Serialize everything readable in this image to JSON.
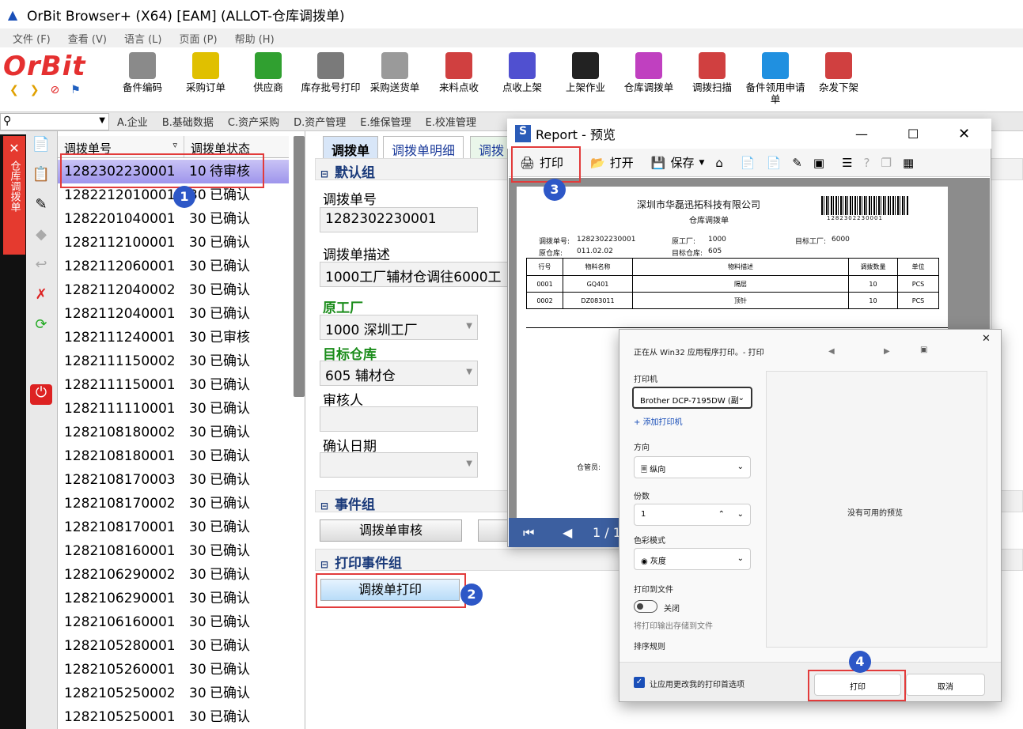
{
  "window": {
    "title": "OrBit Browser+ (X64) [EAM] (ALLOT-仓库调拨单)"
  },
  "menu": [
    "文件 (F)",
    "查看 (V)",
    "语言 (L)",
    "页面 (P)",
    "帮助 (H)"
  ],
  "brand": "OrBit",
  "toolbar": [
    {
      "label": "备件编码",
      "icon": "parts-code-icon"
    },
    {
      "label": "采购订单",
      "icon": "purchase-cart-icon"
    },
    {
      "label": "供应商",
      "icon": "supplier-icon"
    },
    {
      "label": "库存批号打印",
      "icon": "batch-print-icon"
    },
    {
      "label": "采购送货单",
      "icon": "delivery-note-icon"
    },
    {
      "label": "来料点收",
      "icon": "receive-icon"
    },
    {
      "label": "点收上架",
      "icon": "shelve-icon"
    },
    {
      "label": "上架作业",
      "icon": "shelving-op-icon"
    },
    {
      "label": "仓库调拨单",
      "icon": "transfer-icon"
    },
    {
      "label": "调拨扫描",
      "icon": "scan-icon"
    },
    {
      "label": "备件领用申请单",
      "icon": "request-icon"
    },
    {
      "label": "杂发下架",
      "icon": "misc-issue-icon"
    }
  ],
  "nav": [
    "A.企业",
    "B.基础数据",
    "C.资产采购",
    "D.资产管理",
    "E.维保管理",
    "E.校准管理"
  ],
  "sidetab": "仓库调拨单",
  "list": {
    "headers": [
      "调拨单号",
      "调拨单状态"
    ],
    "rows": [
      [
        "1282302230001",
        "10",
        "待审核"
      ],
      [
        "1282212010001",
        "30",
        "已确认"
      ],
      [
        "1282201040001",
        "30",
        "已确认"
      ],
      [
        "1282112100001",
        "30",
        "已确认"
      ],
      [
        "1282112060001",
        "30",
        "已确认"
      ],
      [
        "1282112040002",
        "30",
        "已确认"
      ],
      [
        "1282112040001",
        "30",
        "已确认"
      ],
      [
        "1282111240001",
        "30",
        "已审核"
      ],
      [
        "1282111150002",
        "30",
        "已确认"
      ],
      [
        "1282111150001",
        "30",
        "已确认"
      ],
      [
        "1282111110001",
        "30",
        "已确认"
      ],
      [
        "1282108180002",
        "30",
        "已确认"
      ],
      [
        "1282108180001",
        "30",
        "已确认"
      ],
      [
        "1282108170003",
        "30",
        "已确认"
      ],
      [
        "1282108170002",
        "30",
        "已确认"
      ],
      [
        "1282108170001",
        "30",
        "已确认"
      ],
      [
        "1282108160001",
        "30",
        "已确认"
      ],
      [
        "1282106290002",
        "30",
        "已确认"
      ],
      [
        "1282106290001",
        "30",
        "已确认"
      ],
      [
        "1282106160001",
        "30",
        "已确认"
      ],
      [
        "1282105280001",
        "30",
        "已确认"
      ],
      [
        "1282105260001",
        "30",
        "已确认"
      ],
      [
        "1282105250002",
        "30",
        "已确认"
      ],
      [
        "1282105250001",
        "30",
        "已确认"
      ]
    ]
  },
  "form": {
    "tabs": [
      "调拨单",
      "调拨单明细",
      "调拨"
    ],
    "group_default": "默认组",
    "lbl_no": "调拨单号",
    "val_no": "1282302230001",
    "lbl_desc": "调拨单描述",
    "val_desc": "1000工厂辅材仓调往6000工",
    "lbl_factory": "原工厂",
    "val_factory": "1000 深圳工厂",
    "lbl_wh": "目标仓库",
    "val_wh": "605 辅材仓",
    "lbl_auditor": "审核人",
    "lbl_confirm": "确认日期",
    "group_event": "事件组",
    "btn_audit": "调拨单审核",
    "group_print": "打印事件组",
    "btn_print": "调拨单打印"
  },
  "report": {
    "title": "Report - 预览",
    "tools": {
      "print": "打印",
      "open": "打开",
      "save": "保存"
    },
    "company": "深圳市华磊迅拓科技有限公司",
    "doc_title": "仓库调拨单",
    "barcode_text": "1282302230001",
    "h_no": "调拨单号:",
    "no": "1282302230001",
    "h_src_factory": "原工厂:",
    "src_factory": "1000",
    "h_dst_factory": "目标工厂:",
    "dst_factory": "6000",
    "h_src_wh": "原仓库:",
    "src_wh": "011.02.02",
    "h_dst_wh": "目标仓库:",
    "dst_wh": "605",
    "cols": [
      "行号",
      "物料名称",
      "物料描述",
      "调拨数量",
      "单位"
    ],
    "rows": [
      [
        "0001",
        "GQ401",
        "隔层",
        "10",
        "PCS"
      ],
      [
        "0002",
        "DZ083011",
        "顶针",
        "10",
        "PCS"
      ]
    ],
    "keeper": "仓管员:",
    "page": "1 / 1"
  },
  "print_dialog": {
    "header": "正在从 Win32 应用程序打印。- 打印",
    "printer_label": "打印机",
    "printer": "Brother DCP-7195DW (副",
    "add_printer": "添加打印机",
    "orient_label": "方向",
    "orient": "纵向",
    "copies_label": "份数",
    "copies": "1",
    "color_label": "色彩模式",
    "color": "灰度",
    "file_label": "打印到文件",
    "file_toggle": "关闭",
    "file_hint": "将打印输出存储到文件",
    "sort_label": "排序规则",
    "preview": "没有可用的预览",
    "allow_change": "让应用更改我的打印首选项",
    "print": "打印",
    "cancel": "取消"
  },
  "badges": [
    "1",
    "2",
    "3",
    "4"
  ]
}
